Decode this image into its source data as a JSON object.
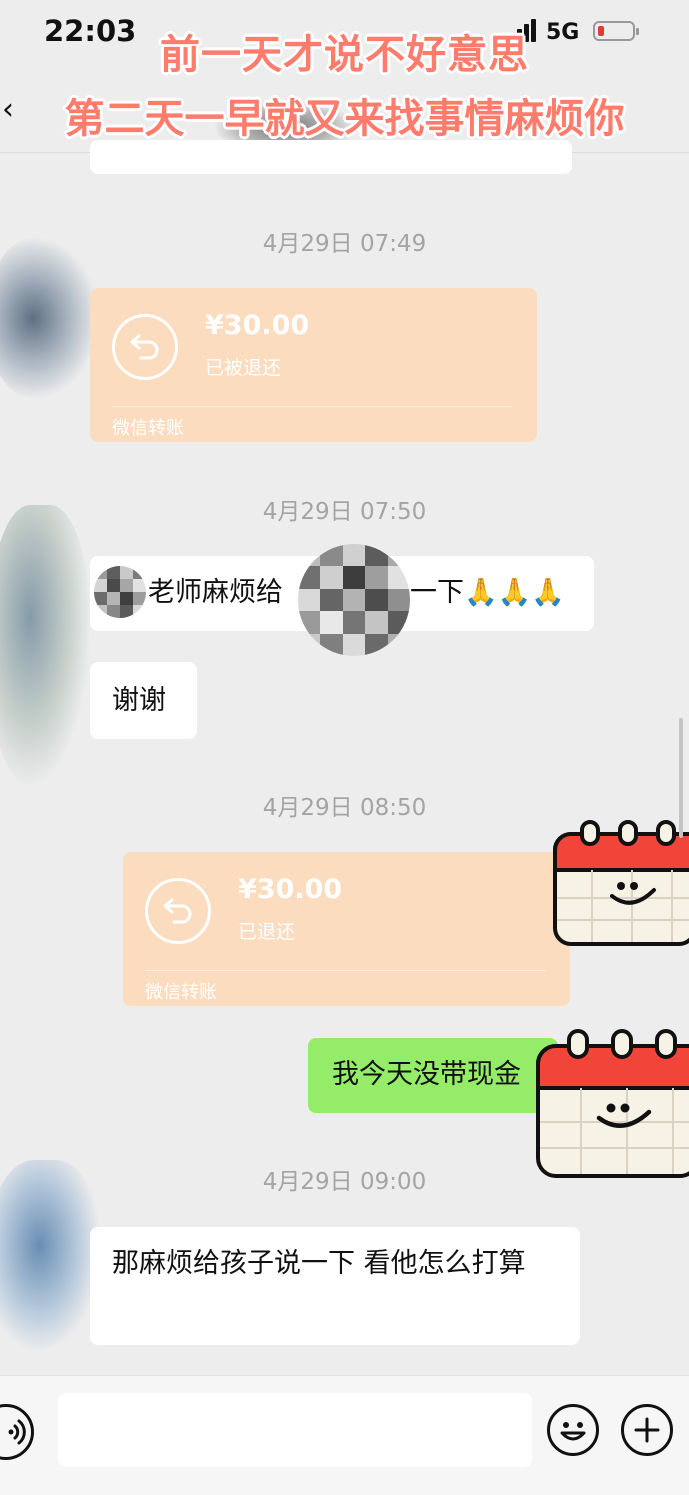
{
  "status_bar": {
    "time": "22:03",
    "network": "5G",
    "battery_color": "#e53935"
  },
  "header": {
    "back_icon": "chevron-left-icon"
  },
  "caption": {
    "line1": "前一天才说不好意思",
    "line2": "第二天一早就又来找事情麻烦你",
    "color": "#ff7b6b"
  },
  "messages": {
    "ts1": "4月29日 07:49",
    "transfer1": {
      "amount": "¥30.00",
      "status": "已被退还",
      "label": "微信转账"
    },
    "ts2": "4月29日 07:50",
    "msg1_part1": "老师麻烦给",
    "msg1_part2": "一下🙏🙏🙏",
    "msg2": "谢谢",
    "ts3": "4月29日 08:50",
    "transfer2": {
      "amount": "¥30.00",
      "status": "已退还",
      "label": "微信转账"
    },
    "my_msg": "我今天没带现金",
    "ts4": "4月29日 09:00",
    "msg3": "那麻烦给孩子说一下 看他怎么打算"
  },
  "colors": {
    "transfer_bg": "#fbdcbf",
    "my_bubble": "#95ec69",
    "background": "#ededed"
  },
  "bottom_bar": {
    "voice_icon": "voice-icon",
    "emoji_icon": "emoji-icon",
    "plus_icon": "plus-icon",
    "input_value": ""
  }
}
